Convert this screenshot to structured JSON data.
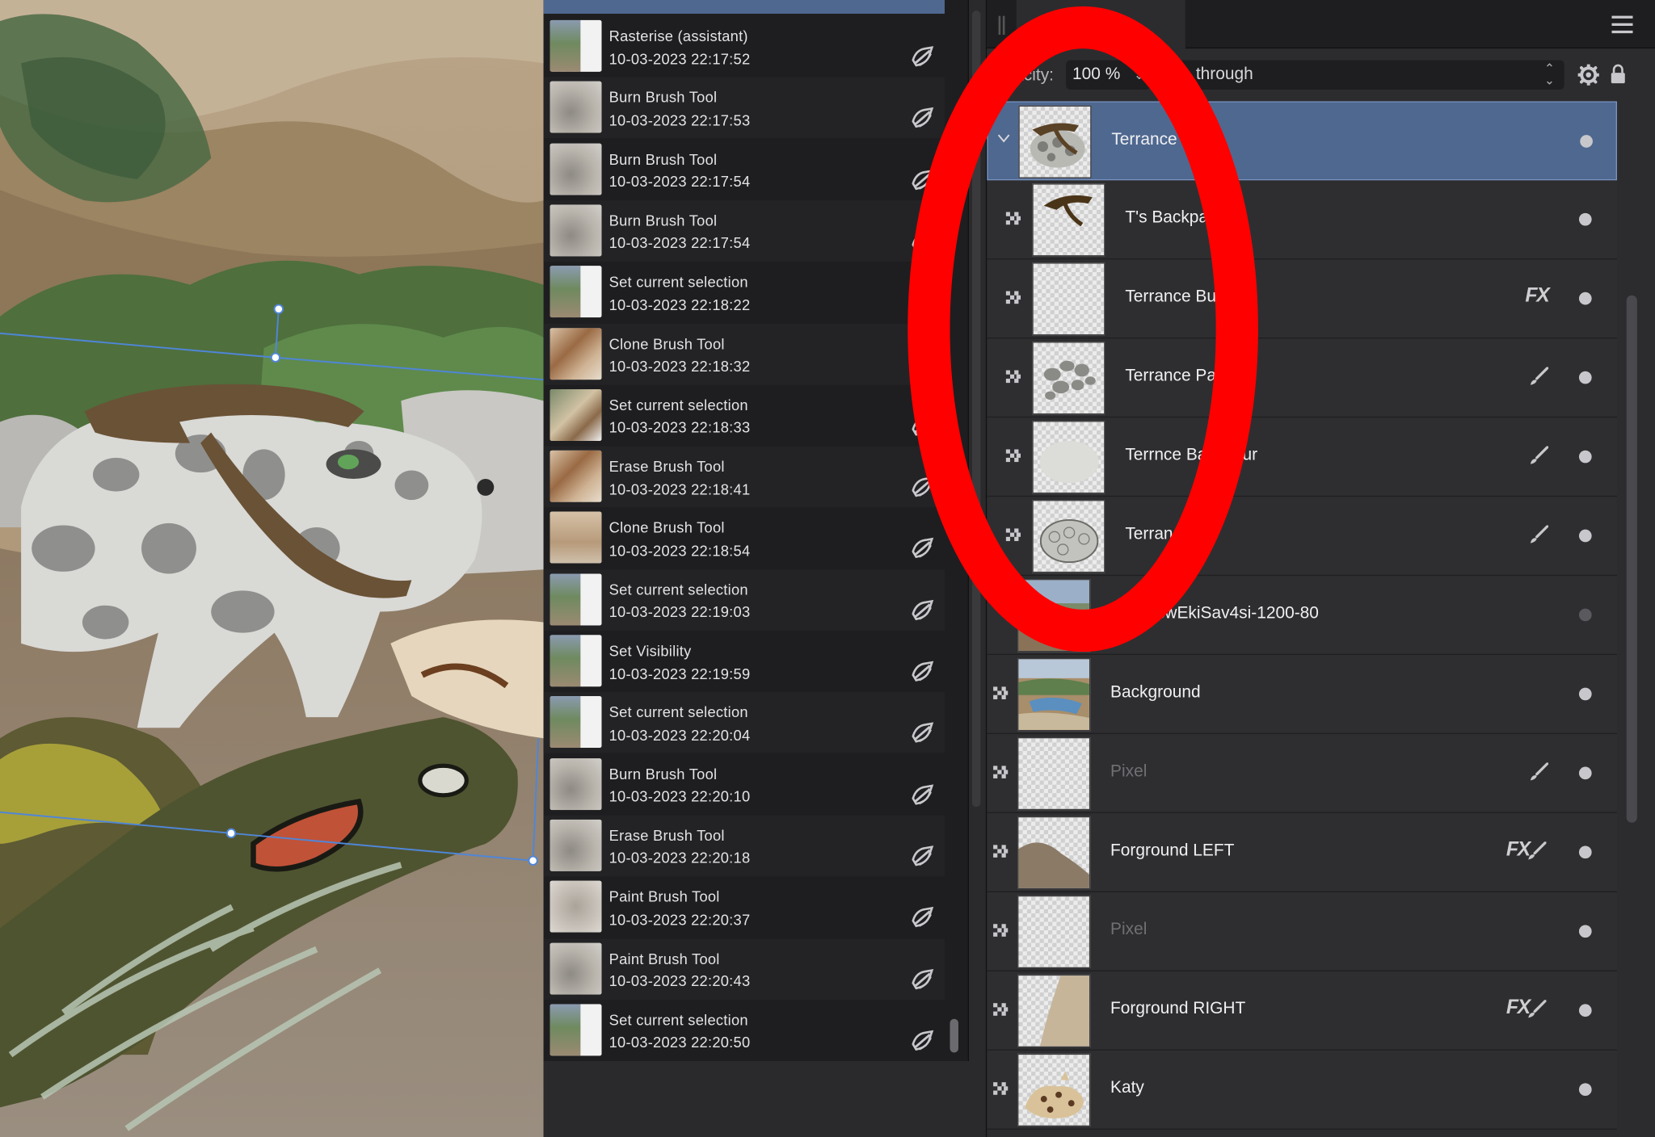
{
  "history": {
    "items": [
      {
        "name": "Rasterise (assistant)",
        "time": "10-03-2023 22:17:52",
        "thumb": "scene"
      },
      {
        "name": "Burn Brush Tool",
        "time": "10-03-2023 22:17:53",
        "thumb": "gray"
      },
      {
        "name": "Burn Brush Tool",
        "time": "10-03-2023 22:17:54",
        "thumb": "gray"
      },
      {
        "name": "Burn Brush Tool",
        "time": "10-03-2023 22:17:54",
        "thumb": "gray"
      },
      {
        "name": "Set current selection",
        "time": "10-03-2023 22:18:22",
        "thumb": "scene"
      },
      {
        "name": "Clone Brush Tool",
        "time": "10-03-2023 22:18:32",
        "thumb": "brown"
      },
      {
        "name": "Set current selection",
        "time": "10-03-2023 22:18:33",
        "thumb": "cat"
      },
      {
        "name": "Erase Brush Tool",
        "time": "10-03-2023 22:18:41",
        "thumb": "brown"
      },
      {
        "name": "Clone Brush Tool",
        "time": "10-03-2023 22:18:54",
        "thumb": "tan"
      },
      {
        "name": "Set current selection",
        "time": "10-03-2023 22:19:03",
        "thumb": "scene"
      },
      {
        "name": "Set Visibility",
        "time": "10-03-2023 22:19:59",
        "thumb": "scene"
      },
      {
        "name": "Set current selection",
        "time": "10-03-2023 22:20:04",
        "thumb": "scene"
      },
      {
        "name": "Burn Brush Tool",
        "time": "10-03-2023 22:20:10",
        "thumb": "gray"
      },
      {
        "name": "Erase Brush Tool",
        "time": "10-03-2023 22:20:18",
        "thumb": "gray"
      },
      {
        "name": "Paint Brush Tool",
        "time": "10-03-2023 22:20:37",
        "thumb": "blur"
      },
      {
        "name": "Paint Brush Tool",
        "time": "10-03-2023 22:20:43",
        "thumb": "gray"
      },
      {
        "name": "Set current selection",
        "time": "10-03-2023 22:20:50",
        "thumb": "scene"
      }
    ]
  },
  "layers_panel": {
    "tab_label": "s",
    "opacity_label": "acity:",
    "opacity_value": "100 %",
    "blend_mode": "through",
    "layers": [
      {
        "name": "Terrance G      P",
        "kind": "group",
        "selected": true,
        "child": false,
        "fx": false,
        "brush": false,
        "visible": true,
        "dim": false,
        "thumb": "toad-pack"
      },
      {
        "name": "T's Backpac",
        "kind": "pixel",
        "selected": false,
        "child": true,
        "fx": false,
        "brush": false,
        "visible": true,
        "dim": false,
        "thumb": "pack"
      },
      {
        "name": "Terrance Bum",
        "kind": "pixel",
        "selected": false,
        "child": true,
        "fx": true,
        "brush": false,
        "visible": true,
        "dim": false,
        "thumb": "empty"
      },
      {
        "name": "Terrance Patc",
        "kind": "pixel",
        "selected": false,
        "child": true,
        "fx": false,
        "brush": true,
        "visible": true,
        "dim": false,
        "thumb": "patches"
      },
      {
        "name": "Terrnce Bas      olour",
        "kind": "pixel",
        "selected": false,
        "child": true,
        "fx": false,
        "brush": true,
        "visible": true,
        "dim": false,
        "thumb": "base"
      },
      {
        "name": "Terranc",
        "kind": "pixel",
        "selected": false,
        "child": true,
        "fx": false,
        "brush": true,
        "visible": true,
        "dim": false,
        "thumb": "sketch"
      },
      {
        "name": "ACBKcwEkiSav4si-1200-80",
        "kind": "image",
        "selected": false,
        "child": false,
        "fx": false,
        "brush": false,
        "visible": false,
        "dim": false,
        "thumb": "photo"
      },
      {
        "name": "Background",
        "kind": "pixel",
        "selected": false,
        "child": false,
        "fx": false,
        "brush": false,
        "visible": true,
        "dim": false,
        "thumb": "landscape"
      },
      {
        "name": "Pixel",
        "kind": "pixel",
        "selected": false,
        "child": false,
        "fx": false,
        "brush": true,
        "visible": true,
        "dim": true,
        "thumb": "empty"
      },
      {
        "name": "Forground LEFT",
        "kind": "pixel",
        "selected": false,
        "child": false,
        "fx": true,
        "brush": true,
        "visible": true,
        "dim": false,
        "thumb": "left"
      },
      {
        "name": "Pixel",
        "kind": "pixel",
        "selected": false,
        "child": false,
        "fx": false,
        "brush": false,
        "visible": true,
        "dim": true,
        "thumb": "empty"
      },
      {
        "name": "Forground RIGHT",
        "kind": "pixel",
        "selected": false,
        "child": false,
        "fx": true,
        "brush": true,
        "visible": true,
        "dim": false,
        "thumb": "right"
      },
      {
        "name": "Katy",
        "kind": "pixel",
        "selected": false,
        "child": false,
        "fx": false,
        "brush": false,
        "visible": true,
        "dim": false,
        "thumb": "cat"
      }
    ]
  },
  "icons": {
    "history_step": "snapshot-icon",
    "pixel_layer": "pixel-layer-icon",
    "fx": "fx-icon",
    "brush": "brush-icon",
    "visibility": "visibility-dot-icon",
    "gear": "gear-icon",
    "lock": "lock-icon",
    "menu": "hamburger-menu-icon",
    "expand": "chevron-down-icon"
  },
  "fx_label": "FX",
  "colors": {
    "selected_row": "#4f6890",
    "annotation": "#ff0000"
  }
}
